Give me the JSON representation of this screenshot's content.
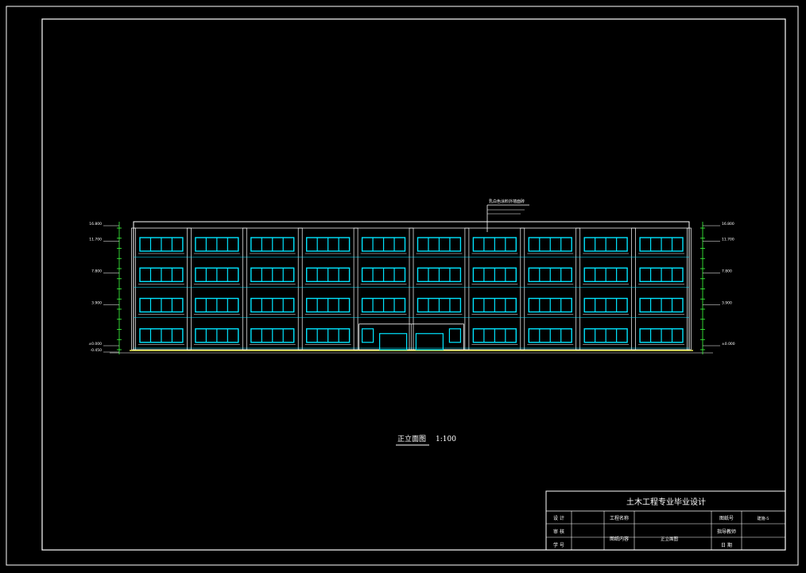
{
  "drawing": {
    "caption": "正立面图",
    "scale": "1:100",
    "leader_note": "乳白色涂料外墙面砖",
    "level_labels_left": [
      "16.800",
      "11.700",
      "7.800",
      "3.900",
      "±0.000",
      "-0.450"
    ],
    "level_labels_right": [
      "16.800",
      "11.700",
      "7.800",
      "3.900",
      "±0.000"
    ]
  },
  "facade": {
    "floors": 4,
    "bays": 10,
    "windows_per_bay": 4,
    "entrance_bays": [
      4,
      5
    ]
  },
  "title_block": {
    "title": "土木工程专业毕业设计",
    "rows": [
      {
        "label": "设 计",
        "label2": "工程名称",
        "label3": "图纸号",
        "value3": "建施-5"
      },
      {
        "label": "审 核",
        "label2": "",
        "label3": "指导教师",
        "value3": ""
      },
      {
        "label": "学 号",
        "label2": "图纸内容",
        "label3": "日 期",
        "value3": ""
      }
    ],
    "content_value": "正立面图"
  },
  "colors": {
    "background": "#000000",
    "frame": "#ffffff",
    "window": "#00e5ff",
    "dimension": "#3cff3c",
    "ground": "#e6e64a"
  }
}
